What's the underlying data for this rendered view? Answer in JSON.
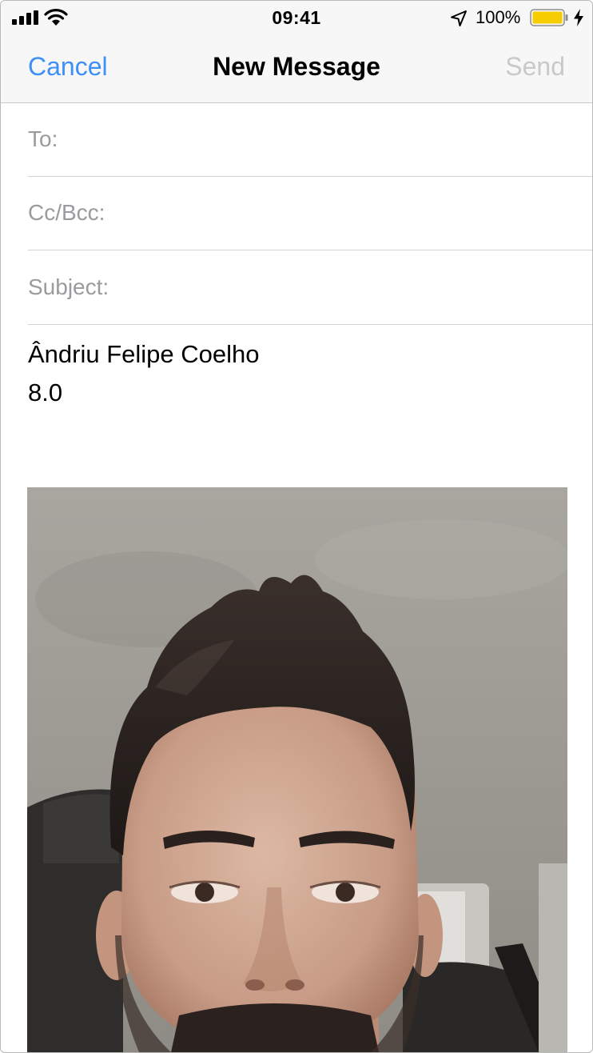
{
  "status_bar": {
    "time": "09:41",
    "battery_percent": "100%",
    "icons": [
      "signal-icon",
      "wifi-icon",
      "location-arrow-icon",
      "battery-icon",
      "charging-bolt-icon"
    ],
    "battery_color": "#f6cd00"
  },
  "nav": {
    "cancel": "Cancel",
    "title": "New Message",
    "send": "Send",
    "accent_color": "#3e8ff6"
  },
  "fields": {
    "to_label": "To:",
    "to_value": "",
    "cc_label": "Cc/Bcc:",
    "cc_value": "",
    "subject_label": "Subject:",
    "subject_value": ""
  },
  "body": {
    "line1": "Ândriu Felipe Coelho",
    "line2": "8.0"
  },
  "attachment": {
    "type": "photo",
    "subject": "selfie of a man in a car"
  }
}
